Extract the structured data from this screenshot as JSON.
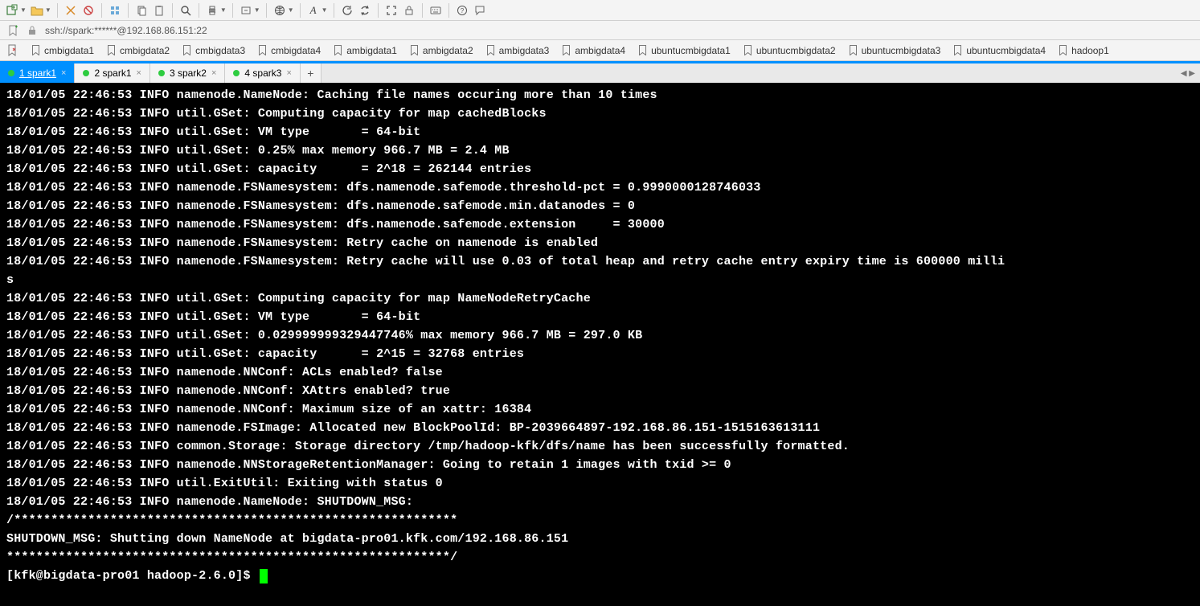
{
  "address": "ssh://spark:******@192.168.86.151:22",
  "bookmarks": [
    "cmbigdata1",
    "cmbigdata2",
    "cmbigdata3",
    "cmbigdata4",
    "ambigdata1",
    "ambigdata2",
    "ambigdata3",
    "ambigdata4",
    "ubuntucmbigdata1",
    "ubuntucmbigdata2",
    "ubuntucmbigdata3",
    "ubuntucmbigdata4",
    "hadoop1"
  ],
  "tabs": [
    {
      "label": "1 spark1",
      "active": true
    },
    {
      "label": "2 spark1",
      "active": false
    },
    {
      "label": "3 spark2",
      "active": false
    },
    {
      "label": "4 spark3",
      "active": false
    }
  ],
  "terminal_lines": [
    "18/01/05 22:46:53 INFO namenode.NameNode: Caching file names occuring more than 10 times",
    "18/01/05 22:46:53 INFO util.GSet: Computing capacity for map cachedBlocks",
    "18/01/05 22:46:53 INFO util.GSet: VM type       = 64-bit",
    "18/01/05 22:46:53 INFO util.GSet: 0.25% max memory 966.7 MB = 2.4 MB",
    "18/01/05 22:46:53 INFO util.GSet: capacity      = 2^18 = 262144 entries",
    "18/01/05 22:46:53 INFO namenode.FSNamesystem: dfs.namenode.safemode.threshold-pct = 0.9990000128746033",
    "18/01/05 22:46:53 INFO namenode.FSNamesystem: dfs.namenode.safemode.min.datanodes = 0",
    "18/01/05 22:46:53 INFO namenode.FSNamesystem: dfs.namenode.safemode.extension     = 30000",
    "18/01/05 22:46:53 INFO namenode.FSNamesystem: Retry cache on namenode is enabled",
    "18/01/05 22:46:53 INFO namenode.FSNamesystem: Retry cache will use 0.03 of total heap and retry cache entry expiry time is 600000 milli",
    "s",
    "18/01/05 22:46:53 INFO util.GSet: Computing capacity for map NameNodeRetryCache",
    "18/01/05 22:46:53 INFO util.GSet: VM type       = 64-bit",
    "18/01/05 22:46:53 INFO util.GSet: 0.029999999329447746% max memory 966.7 MB = 297.0 KB",
    "18/01/05 22:46:53 INFO util.GSet: capacity      = 2^15 = 32768 entries",
    "18/01/05 22:46:53 INFO namenode.NNConf: ACLs enabled? false",
    "18/01/05 22:46:53 INFO namenode.NNConf: XAttrs enabled? true",
    "18/01/05 22:46:53 INFO namenode.NNConf: Maximum size of an xattr: 16384",
    "18/01/05 22:46:53 INFO namenode.FSImage: Allocated new BlockPoolId: BP-2039664897-192.168.86.151-1515163613111",
    "18/01/05 22:46:53 INFO common.Storage: Storage directory /tmp/hadoop-kfk/dfs/name has been successfully formatted.",
    "18/01/05 22:46:53 INFO namenode.NNStorageRetentionManager: Going to retain 1 images with txid >= 0",
    "18/01/05 22:46:53 INFO util.ExitUtil: Exiting with status 0",
    "18/01/05 22:46:53 INFO namenode.NameNode: SHUTDOWN_MSG:",
    "/************************************************************",
    "SHUTDOWN_MSG: Shutting down NameNode at bigdata-pro01.kfk.com/192.168.86.151",
    "************************************************************/"
  ],
  "prompt": "[kfk@bigdata-pro01 hadoop-2.6.0]$ "
}
